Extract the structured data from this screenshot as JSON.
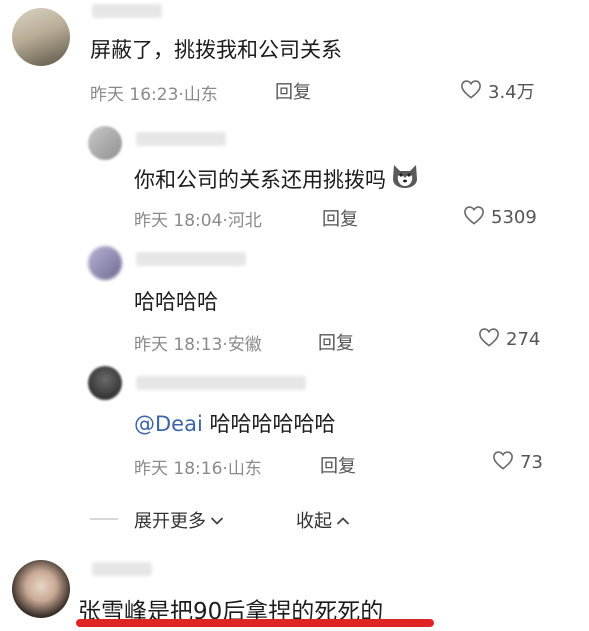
{
  "comments": [
    {
      "text": "屏蔽了，挑拨我和公司关系",
      "time": "昨天 16:23",
      "location": "山东",
      "reply_label": "回复",
      "likes": "3.4万"
    }
  ],
  "replies": [
    {
      "text": "你和公司的关系还用挑拨吗",
      "time": "昨天 18:04",
      "location": "河北",
      "reply_label": "回复",
      "likes": "5309"
    },
    {
      "text": "哈哈哈哈",
      "time": "昨天 18:13",
      "location": "安徽",
      "reply_label": "回复",
      "likes": "274"
    },
    {
      "mention": "@Deai",
      "text": " 哈哈哈哈哈哈",
      "time": "昨天 18:16",
      "location": "山东",
      "reply_label": "回复",
      "likes": "73"
    }
  ],
  "thread_controls": {
    "expand_label": "展开更多",
    "collapse_label": "收起"
  },
  "last_comment": {
    "text": "张雪峰是把90后拿捏的死死的"
  },
  "colors": {
    "mention": "#3b64a8",
    "highlight_underline": "#e02424"
  }
}
